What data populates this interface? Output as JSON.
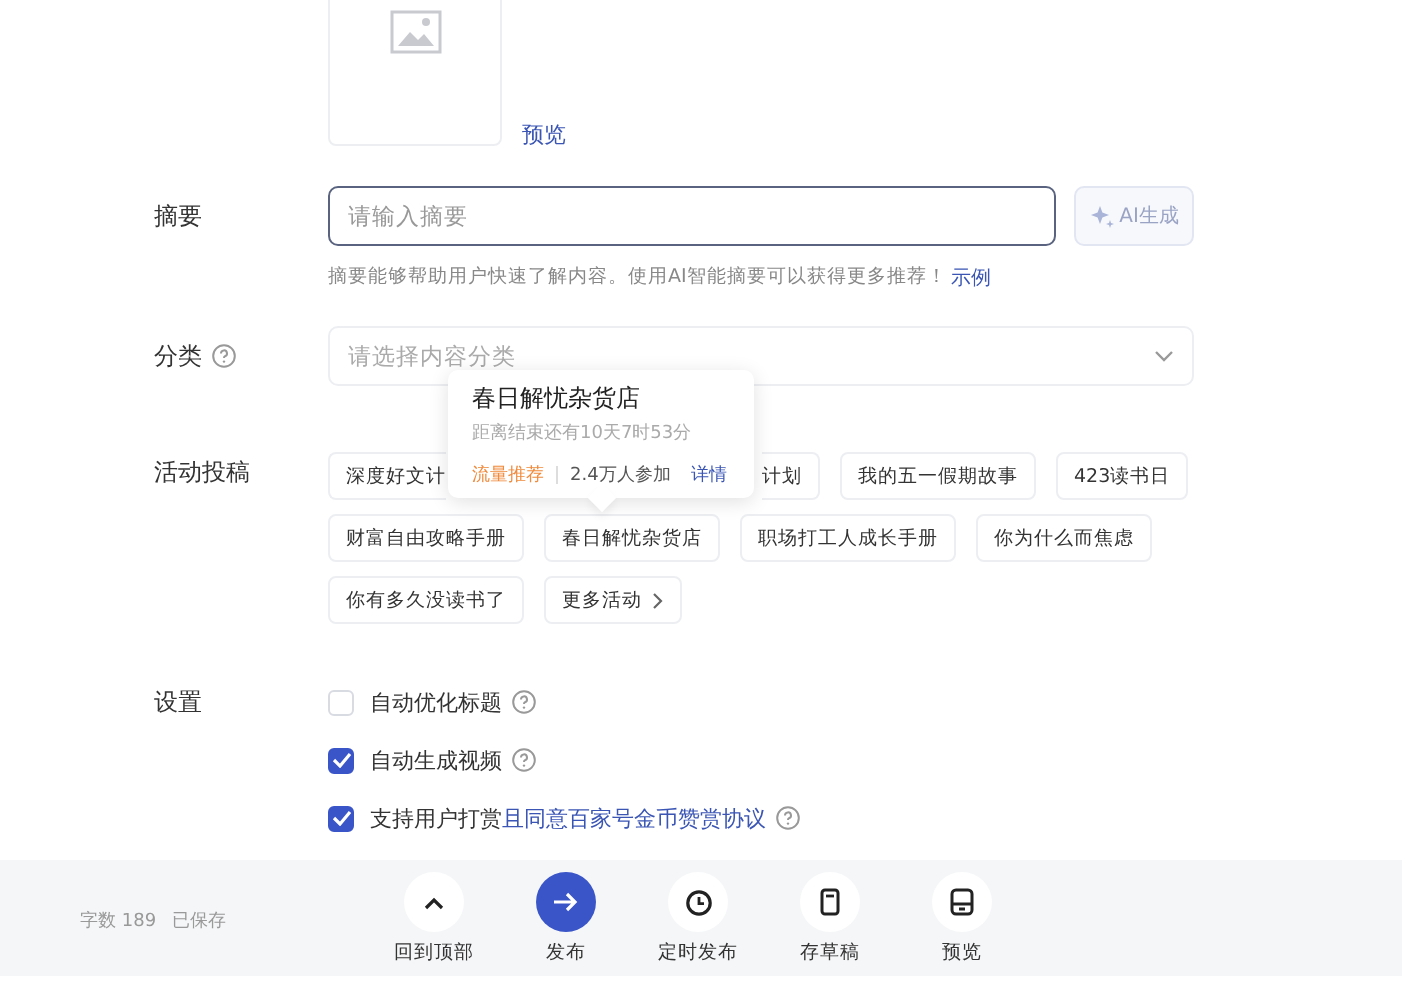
{
  "cover": {
    "preview_link": "预览"
  },
  "summary": {
    "label": "摘要",
    "placeholder": "请输入摘要",
    "ai_button": "AI生成",
    "hint": "摘要能够帮助用户快速了解内容。使用AI智能摘要可以获得更多推荐！",
    "hint_link": "示例"
  },
  "category": {
    "label": "分类",
    "placeholder": "请选择内容分类"
  },
  "activities": {
    "label": "活动投稿",
    "tags": [
      {
        "text": "深度好文计",
        "kind": "cut-right"
      },
      {
        "text": "计划",
        "kind": "cut-left"
      },
      {
        "text": "我的五一假期故事",
        "kind": "tag"
      },
      {
        "text": "423读书日",
        "kind": "tag"
      },
      {
        "text": "财富自由攻略手册",
        "kind": "tag"
      },
      {
        "text": "春日解忧杂货店",
        "kind": "tag"
      },
      {
        "text": "职场打工人成长手册",
        "kind": "tag"
      },
      {
        "text": "你为什么而焦虑",
        "kind": "tag"
      },
      {
        "text": "你有多久没读书了",
        "kind": "tag"
      },
      {
        "text": "更多活动",
        "kind": "more"
      }
    ]
  },
  "popover": {
    "title": "春日解忧杂货店",
    "countdown": "距离结束还有10天7时53分",
    "badge": "流量推荐",
    "participants": "2.4万人参加",
    "details": "详情"
  },
  "settings": {
    "label": "设置",
    "options": [
      {
        "text": "自动优化标题",
        "checked": false
      },
      {
        "text": "自动生成视频",
        "checked": true
      },
      {
        "text": "支持用户打赏",
        "link": "且同意百家号金币赞赏协议",
        "checked": true
      }
    ]
  },
  "footer": {
    "word_count": "字数 189",
    "saved": "已保存",
    "actions": [
      {
        "label": "回到顶部",
        "kind": "top",
        "primary": false
      },
      {
        "label": "发布",
        "kind": "publish",
        "primary": true
      },
      {
        "label": "定时发布",
        "kind": "schedule",
        "primary": false
      },
      {
        "label": "存草稿",
        "kind": "draft",
        "primary": false
      },
      {
        "label": "预览",
        "kind": "preview",
        "primary": false
      }
    ]
  }
}
